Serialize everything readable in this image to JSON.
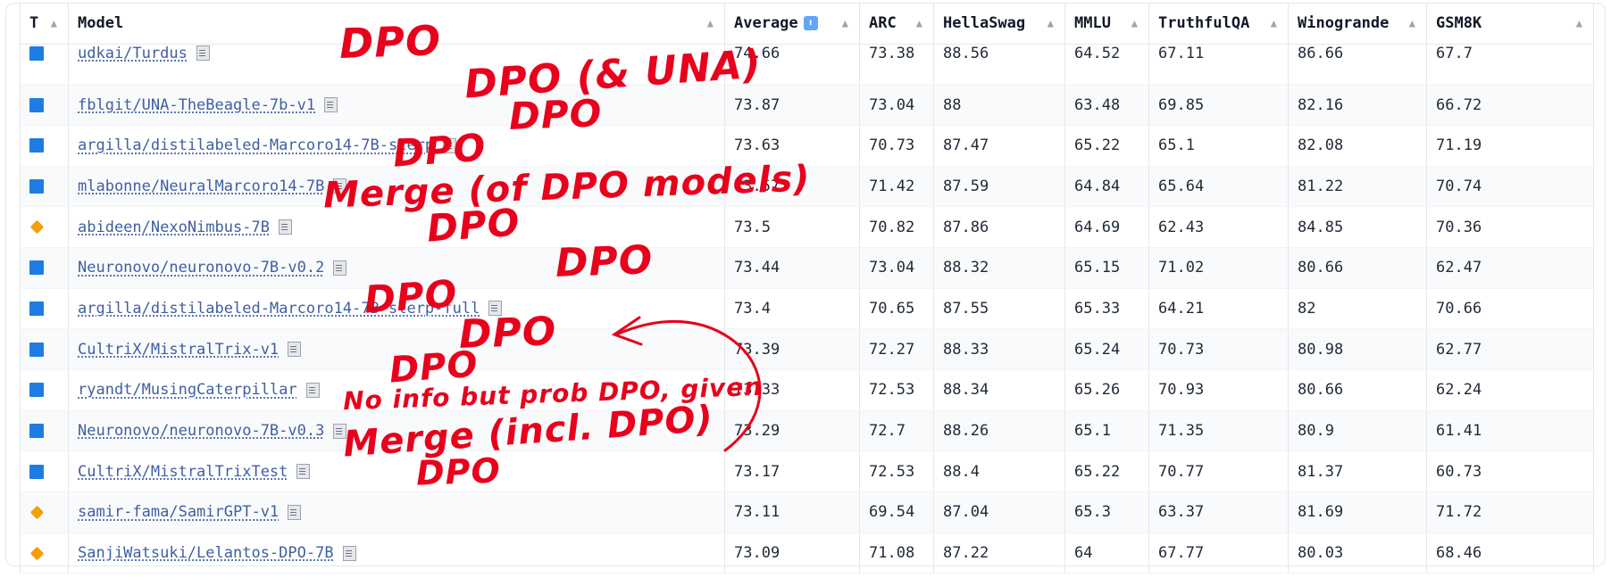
{
  "columns": {
    "type": "T",
    "model": "Model",
    "average": "Average",
    "arc": "ARC",
    "hellaswag": "HellaSwag",
    "mmlu": "MMLU",
    "truthfulqa": "TruthfulQA",
    "winogrande": "Winogrande",
    "gsm8k": "GSM8K"
  },
  "sort_glyph": "▲",
  "average_icon": "⬆",
  "rows": [
    {
      "type": "square",
      "model": "udkai/Turdus",
      "average": "74.66",
      "arc": "73.38",
      "hellaswag": "88.56",
      "mmlu": "64.52",
      "truthfulqa": "67.11",
      "winogrande": "86.66",
      "gsm8k": "67.7"
    },
    {
      "type": "square",
      "model": "fblgit/UNA-TheBeagle-7b-v1",
      "average": "73.87",
      "arc": "73.04",
      "hellaswag": "88",
      "mmlu": "63.48",
      "truthfulqa": "69.85",
      "winogrande": "82.16",
      "gsm8k": "66.72"
    },
    {
      "type": "square",
      "model": "argilla/distilabeled-Marcoro14-7B-slerp",
      "average": "73.63",
      "arc": "70.73",
      "hellaswag": "87.47",
      "mmlu": "65.22",
      "truthfulqa": "65.1",
      "winogrande": "82.08",
      "gsm8k": "71.19"
    },
    {
      "type": "square",
      "model": "mlabonne/NeuralMarcoro14-7B",
      "average": "73.57",
      "arc": "71.42",
      "hellaswag": "87.59",
      "mmlu": "64.84",
      "truthfulqa": "65.64",
      "winogrande": "81.22",
      "gsm8k": "70.74"
    },
    {
      "type": "diamond",
      "model": "abideen/NexoNimbus-7B",
      "average": "73.5",
      "arc": "70.82",
      "hellaswag": "87.86",
      "mmlu": "64.69",
      "truthfulqa": "62.43",
      "winogrande": "84.85",
      "gsm8k": "70.36"
    },
    {
      "type": "square",
      "model": "Neuronovo/neuronovo-7B-v0.2",
      "average": "73.44",
      "arc": "73.04",
      "hellaswag": "88.32",
      "mmlu": "65.15",
      "truthfulqa": "71.02",
      "winogrande": "80.66",
      "gsm8k": "62.47"
    },
    {
      "type": "square",
      "model": "argilla/distilabeled-Marcoro14-7B-slerp-full",
      "average": "73.4",
      "arc": "70.65",
      "hellaswag": "87.55",
      "mmlu": "65.33",
      "truthfulqa": "64.21",
      "winogrande": "82",
      "gsm8k": "70.66"
    },
    {
      "type": "square",
      "model": "CultriX/MistralTrix-v1",
      "average": "73.39",
      "arc": "72.27",
      "hellaswag": "88.33",
      "mmlu": "65.24",
      "truthfulqa": "70.73",
      "winogrande": "80.98",
      "gsm8k": "62.77"
    },
    {
      "type": "square",
      "model": "ryandt/MusingCaterpillar",
      "average": "73.33",
      "arc": "72.53",
      "hellaswag": "88.34",
      "mmlu": "65.26",
      "truthfulqa": "70.93",
      "winogrande": "80.66",
      "gsm8k": "62.24"
    },
    {
      "type": "square",
      "model": "Neuronovo/neuronovo-7B-v0.3",
      "average": "73.29",
      "arc": "72.7",
      "hellaswag": "88.26",
      "mmlu": "65.1",
      "truthfulqa": "71.35",
      "winogrande": "80.9",
      "gsm8k": "61.41"
    },
    {
      "type": "square",
      "model": "CultriX/MistralTrixTest",
      "average": "73.17",
      "arc": "72.53",
      "hellaswag": "88.4",
      "mmlu": "65.22",
      "truthfulqa": "70.77",
      "winogrande": "81.37",
      "gsm8k": "60.73"
    },
    {
      "type": "diamond",
      "model": "samir-fama/SamirGPT-v1",
      "average": "73.11",
      "arc": "69.54",
      "hellaswag": "87.04",
      "mmlu": "65.3",
      "truthfulqa": "63.37",
      "winogrande": "81.69",
      "gsm8k": "71.72"
    },
    {
      "type": "diamond",
      "model": "SanjiWatsuki/Lelantos-DPO-7B",
      "average": "73.09",
      "arc": "71.08",
      "hellaswag": "87.22",
      "mmlu": "64",
      "truthfulqa": "67.77",
      "winogrande": "80.03",
      "gsm8k": "68.46"
    }
  ],
  "annotations": [
    "DPO",
    "DPO (& UNA)",
    "DPO",
    "DPO",
    "Merge (of DPO models)",
    "DPO",
    "DPO",
    "DPO",
    "DPO",
    "DPO",
    "No info but prob DPO, given",
    "Merge (incl. DPO)",
    "DPO"
  ],
  "colors": {
    "annotation": "#e8001c",
    "type_square": "#1d7de3",
    "type_diamond": "#f59e0b",
    "link": "#3f5fa3"
  }
}
